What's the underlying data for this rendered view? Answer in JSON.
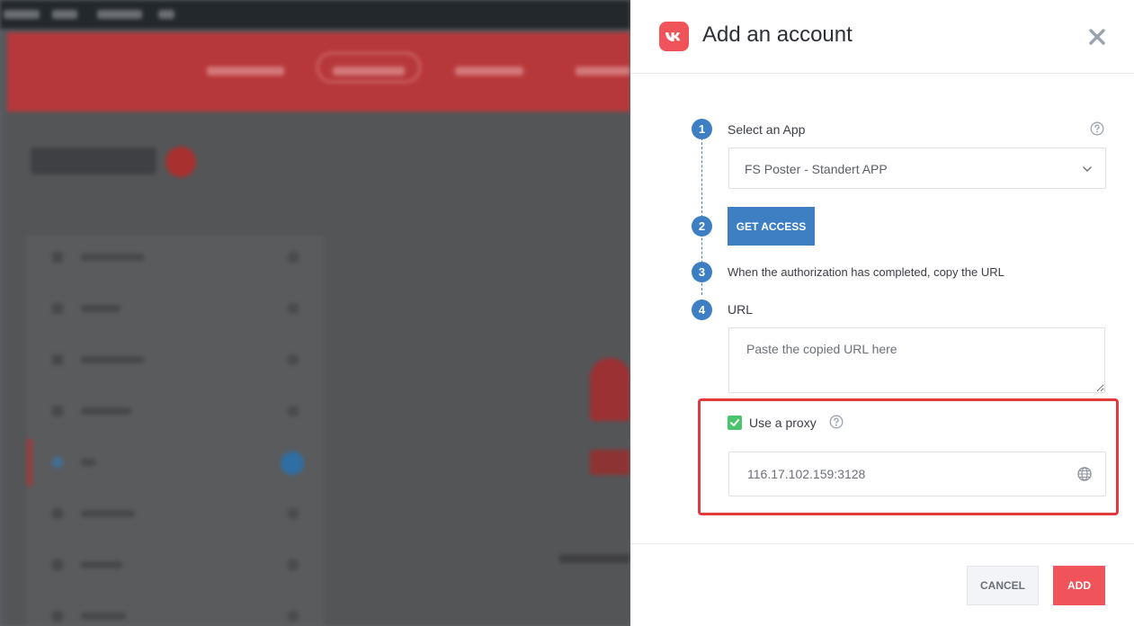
{
  "drawer": {
    "title": "Add an account",
    "brand_color": "#f0545a",
    "accent_color": "#3e7fc3",
    "icons": {
      "logo": "vk-logo-icon",
      "close": "close-icon"
    }
  },
  "steps": [
    {
      "number": "1",
      "label": "Select an App"
    },
    {
      "number": "2",
      "label": ""
    },
    {
      "number": "3",
      "label": "When the authorization has completed, copy the URL"
    },
    {
      "number": "4",
      "label": "URL"
    }
  ],
  "app_select": {
    "value": "FS Poster - Standert APP",
    "icon": "chevron-down-icon"
  },
  "get_access_button": "GET ACCESS",
  "url_field": {
    "value": "",
    "placeholder": "Paste the copied URL here"
  },
  "proxy": {
    "checked": true,
    "label": "Use a proxy",
    "value": "116.17.102.159:3128",
    "icon": "globe-icon",
    "highlight_color": "#e0393e"
  },
  "footer": {
    "cancel_label": "CANCEL",
    "add_label": "ADD"
  }
}
